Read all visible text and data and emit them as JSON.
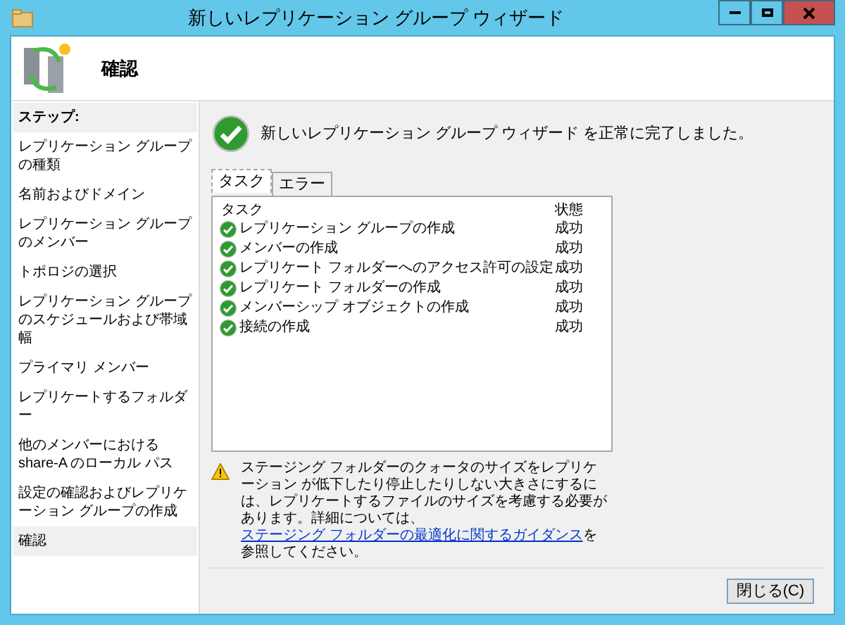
{
  "window": {
    "title": "新しいレプリケーション グループ ウィザード"
  },
  "header": {
    "title": "確認"
  },
  "steps_heading": "ステップ:",
  "steps": [
    {
      "label": "レプリケーション グループの種類",
      "selected": false
    },
    {
      "label": "名前およびドメイン",
      "selected": false
    },
    {
      "label": "レプリケーション グループのメンバー",
      "selected": false
    },
    {
      "label": "トポロジの選択",
      "selected": false
    },
    {
      "label": "レプリケーション グループのスケジュールおよび帯域幅",
      "selected": false
    },
    {
      "label": "プライマリ メンバー",
      "selected": false
    },
    {
      "label": "レプリケートするフォルダー",
      "selected": false
    },
    {
      "label": "他のメンバーにおける share-A のローカル パス",
      "selected": false
    },
    {
      "label": "設定の確認およびレプリケーション グループの作成",
      "selected": false
    },
    {
      "label": "確認",
      "selected": true
    }
  ],
  "message": "新しいレプリケーション グループ ウィザード を正常に完了しました。",
  "tabs": [
    {
      "label": "タスク",
      "selected": true
    },
    {
      "label": "エラー",
      "selected": false
    }
  ],
  "table": {
    "columns": [
      "タスク",
      "状態"
    ],
    "rows": [
      {
        "task": "レプリケーション グループの作成",
        "status": "成功"
      },
      {
        "task": "メンバーの作成",
        "status": "成功"
      },
      {
        "task": "レプリケート フォルダーへのアクセス許可の設定",
        "status": "成功"
      },
      {
        "task": "レプリケート フォルダーの作成",
        "status": "成功"
      },
      {
        "task": "メンバーシップ オブジェクトの作成",
        "status": "成功"
      },
      {
        "task": "接続の作成",
        "status": "成功"
      }
    ]
  },
  "warning": {
    "text": "ステージング フォルダーのクォータのサイズをレプリケーション が低下したり停止したりしない大きさにするには、レプリケートするファイルのサイズを考慮する必要があります。詳細については、",
    "link": "ステージング フォルダーの最適化に関するガイダンス",
    "after": "を参照してください。"
  },
  "buttons": [
    "閉じる(C)"
  ]
}
